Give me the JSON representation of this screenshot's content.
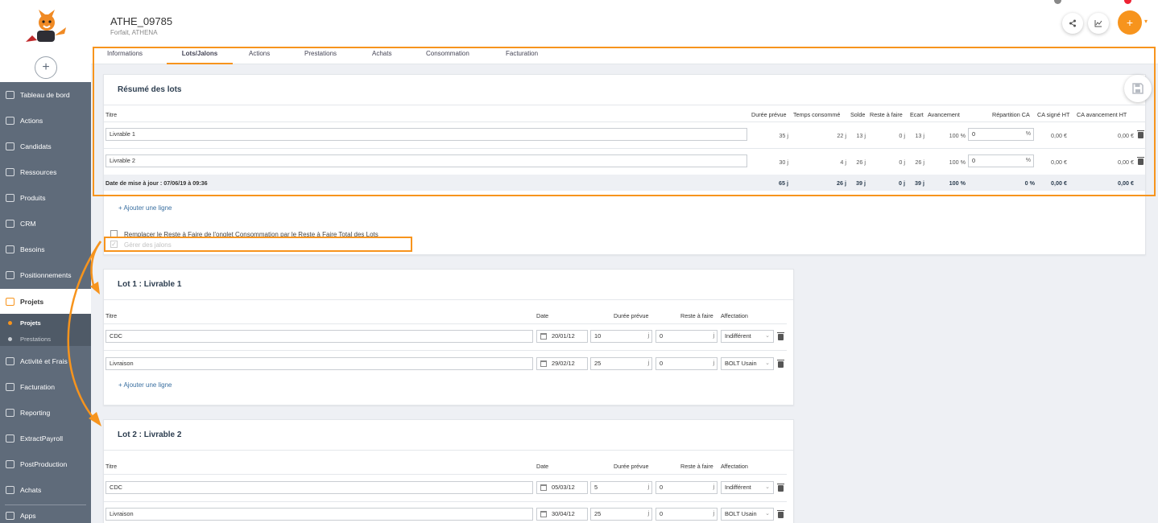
{
  "sidebar": {
    "add_symbol": "+",
    "items": [
      {
        "label": "Tableau de bord",
        "icon": "dashboard-icon"
      },
      {
        "label": "Actions",
        "icon": "actions-icon"
      },
      {
        "label": "Candidats",
        "icon": "graduation-cap-icon"
      },
      {
        "label": "Ressources",
        "icon": "people-icon"
      },
      {
        "label": "Produits",
        "icon": "products-icon"
      },
      {
        "label": "CRM",
        "icon": "crm-icon"
      },
      {
        "label": "Besoins",
        "icon": "target-icon"
      },
      {
        "label": "Positionnements",
        "icon": "pin-icon"
      },
      {
        "label": "Projets",
        "icon": "briefcase-icon"
      },
      {
        "label": "Activité et Frais",
        "icon": "activity-icon"
      },
      {
        "label": "Facturation",
        "icon": "invoice-icon"
      },
      {
        "label": "Reporting",
        "icon": "chart-icon"
      },
      {
        "label": "ExtractPayroll",
        "icon": "extract-icon"
      },
      {
        "label": "PostProduction",
        "icon": "post-icon"
      },
      {
        "label": "Achats",
        "icon": "cart-icon"
      },
      {
        "label": "Apps",
        "icon": "apps-icon"
      }
    ],
    "sub_items": [
      {
        "label": "Projets"
      },
      {
        "label": "Prestations"
      }
    ]
  },
  "header": {
    "title": "ATHE_09785",
    "subtitle": "Forfait, ATHENA",
    "plus": "+",
    "caret": "▾"
  },
  "tabs": [
    "Informations",
    "Lots/Jalons",
    "Actions",
    "Prestations",
    "Achats",
    "Consommation",
    "Facturation"
  ],
  "summary": {
    "title": "Résumé des lots",
    "columns": [
      "Titre",
      "Durée prévue",
      "Temps consommé",
      "Solde",
      "Reste à faire",
      "Ecart",
      "Avancement",
      "Répartition CA",
      "CA signé HT",
      "CA avancement HT"
    ],
    "rows": [
      {
        "titre": "Livrable 1",
        "duree": "35 j",
        "temps": "22 j",
        "solde": "13 j",
        "reste": "0 j",
        "ecart": "13 j",
        "avancement": "100 %",
        "repartition": "0",
        "ca_signe": "0,00 €",
        "ca_avancement": "0,00 €"
      },
      {
        "titre": "Livrable 2",
        "duree": "30 j",
        "temps": "4 j",
        "solde": "26 j",
        "reste": "0 j",
        "ecart": "26 j",
        "avancement": "100 %",
        "repartition": "0",
        "ca_signe": "0,00 €",
        "ca_avancement": "0,00 €"
      }
    ],
    "footer": {
      "label": "Date de mise à jour : 07/06/19 à 09:36",
      "duree": "65 j",
      "temps": "26 j",
      "solde": "39 j",
      "reste": "0 j",
      "ecart": "39 j",
      "avancement": "100 %",
      "repartition": "0 %",
      "ca_signe": "0,00 €",
      "ca_avancement": "0,00 €"
    },
    "percent_unit": "%",
    "add_line": "+ Ajouter une ligne",
    "checkbox_replace": "Remplacer le Reste à Faire de l'onglet Consommation par le Reste à Faire Total des Lots",
    "checkbox_jalons": "Gérer des jalons"
  },
  "lots": [
    {
      "title": "Lot 1 : Livrable 1",
      "columns": [
        "Titre",
        "Date",
        "Durée prévue",
        "Reste à faire",
        "Affectation"
      ],
      "rows": [
        {
          "titre": "CDC",
          "date": "20/01/12",
          "duree": "10",
          "reste": "0",
          "affectation": "Indifférent"
        },
        {
          "titre": "Livraison",
          "date": "29/02/12",
          "duree": "25",
          "reste": "0",
          "affectation": "BOLT Usain"
        }
      ],
      "add_line": "+ Ajouter une ligne"
    },
    {
      "title": "Lot 2 : Livrable 2",
      "columns": [
        "Titre",
        "Date",
        "Durée prévue",
        "Reste à faire",
        "Affectation"
      ],
      "rows": [
        {
          "titre": "CDC",
          "date": "05/03/12",
          "duree": "5",
          "reste": "0",
          "affectation": "Indifférent"
        },
        {
          "titre": "Livraison",
          "date": "30/04/12",
          "duree": "25",
          "reste": "0",
          "affectation": "BOLT Usain"
        }
      ]
    }
  ],
  "day_unit": "j",
  "colors": {
    "accent": "#f7941d",
    "sidebar": "#5f6b7a",
    "link": "#3a6fa0"
  }
}
